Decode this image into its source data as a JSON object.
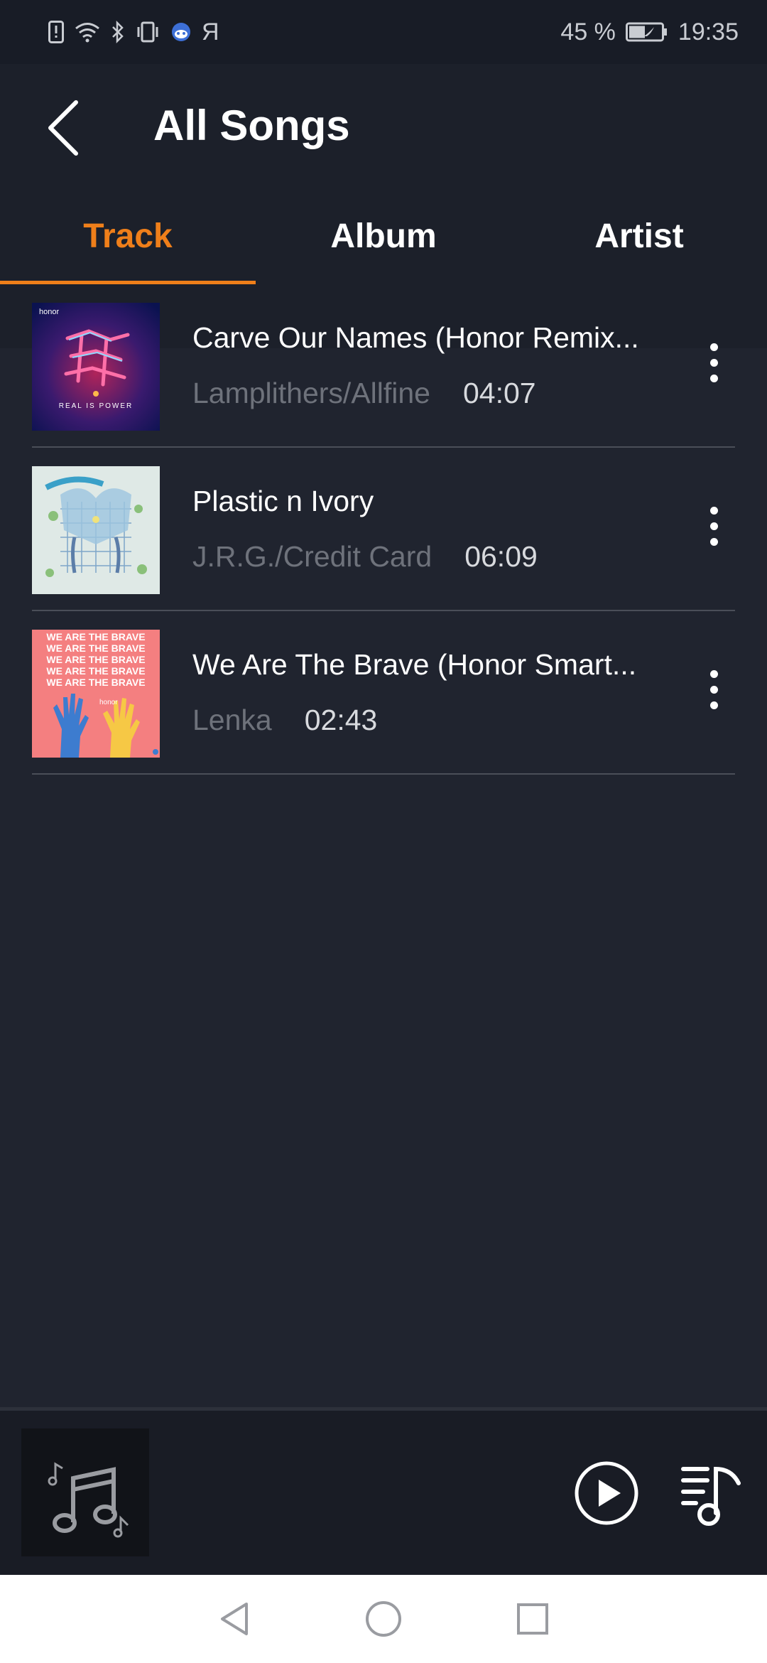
{
  "status_bar": {
    "left_icons": [
      "sim-alert-icon",
      "wifi-icon",
      "bluetooth-icon",
      "vibrate-icon",
      "assistant-icon",
      "yandex-icon"
    ],
    "yandex_glyph": "Я",
    "battery_percent": "45 %",
    "time": "19:35"
  },
  "header": {
    "title": "All Songs",
    "back_icon": "chevron-left-icon"
  },
  "tabs": [
    {
      "label": "Track",
      "active": true
    },
    {
      "label": "Album",
      "active": false
    },
    {
      "label": "Artist",
      "active": false
    }
  ],
  "songs": [
    {
      "title": "Carve Our Names (Honor Remix...",
      "artist": "Lamplithers/Allfine",
      "duration": "04:07",
      "art_icon": "album-art-honor-remix"
    },
    {
      "title": "Plastic n Ivory",
      "artist": "J.R.G./Credit Card",
      "duration": "06:09",
      "art_icon": "album-art-plastic-ivory"
    },
    {
      "title": "We Are The Brave (Honor Smart...",
      "artist": "Lenka",
      "duration": "02:43",
      "art_icon": "album-art-we-are-the-brave"
    }
  ],
  "album_art_text": {
    "honor_logo": "honor",
    "real_is_power": "REAL IS POWER",
    "brave_line": "WE ARE THE BRAVE"
  },
  "player": {
    "art_icon": "music-notes-icon",
    "play_icon": "play-icon",
    "queue_icon": "playlist-icon"
  },
  "nav": {
    "back_icon": "nav-back-icon",
    "home_icon": "nav-home-icon",
    "recents_icon": "nav-recents-icon"
  },
  "colors": {
    "accent": "#ef7f1a",
    "background": "#20242f",
    "header": "#1c202a",
    "status_bar": "#181c26"
  }
}
